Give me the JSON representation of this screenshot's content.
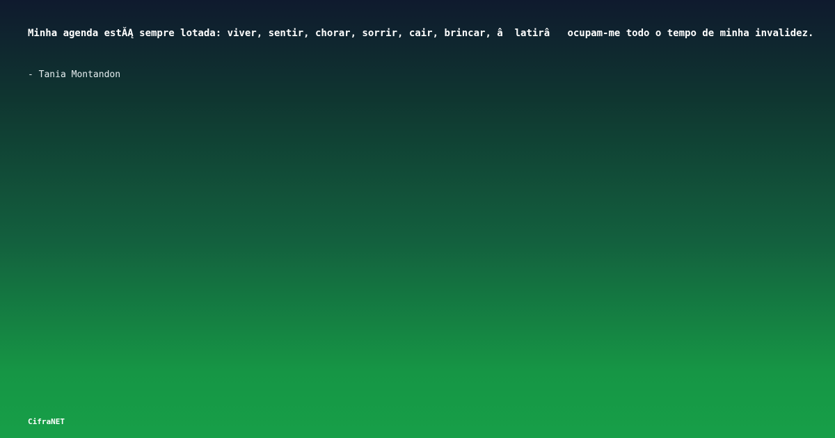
{
  "quote": {
    "text": "Minha agenda estĂĄ sempre lotada: viver, sentir, chorar, sorrir, cair, brincar, â  latirâ   ocupam-me todo o tempo de minha invalidez.",
    "author": "- Tania Montandon"
  },
  "brand": {
    "name": "CifraNET"
  },
  "colors": {
    "background_top": "#0f1a2e",
    "background_bottom": "#179f48",
    "text": "#ffffff"
  }
}
